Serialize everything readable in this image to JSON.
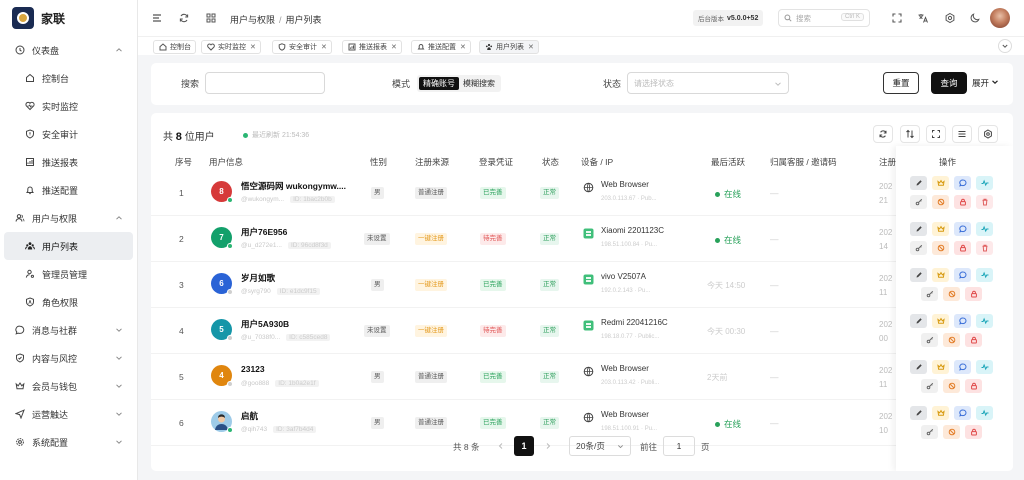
{
  "app": {
    "name": "家联"
  },
  "sidebar": {
    "groups": [
      {
        "label": "仪表盘",
        "expanded": true,
        "items": [
          "控制台",
          "实时监控",
          "安全审计",
          "推送报表",
          "推送配置"
        ]
      },
      {
        "label": "用户与权限",
        "expanded": true,
        "items": [
          "用户列表",
          "管理员管理",
          "角色权限"
        ]
      },
      {
        "label": "消息与社群"
      },
      {
        "label": "内容与风控"
      },
      {
        "label": "会员与钱包"
      },
      {
        "label": "运营触达"
      },
      {
        "label": "系统配置"
      }
    ],
    "active": "用户列表"
  },
  "header": {
    "breadcrumb": [
      "用户与权限",
      "用户列表"
    ],
    "version_label": "后台版本",
    "version": "v5.0.0+52",
    "search_placeholder": "搜索",
    "search_kbd": "Ctrl K"
  },
  "tabs": [
    {
      "label": "控制台",
      "closable": false
    },
    {
      "label": "实时监控",
      "closable": true
    },
    {
      "label": "安全审计",
      "closable": true
    },
    {
      "label": "推送报表",
      "closable": true
    },
    {
      "label": "推送配置",
      "closable": true
    },
    {
      "label": "用户列表",
      "closable": true,
      "active": true
    }
  ],
  "filter": {
    "search_label": "搜索",
    "mode_label": "模式",
    "mode_options": [
      "精确账号",
      "模糊搜索"
    ],
    "mode_selected": "精确账号",
    "status_label": "状态",
    "status_placeholder": "请选择状态",
    "reset": "重置",
    "query": "查询",
    "expand": "展开"
  },
  "table": {
    "count_prefix": "共",
    "count": "8",
    "count_suffix": "位用户",
    "refreshed": "最近刷新 21:54:36",
    "columns": [
      "序号",
      "用户信息",
      "性别",
      "注册来源",
      "登录凭证",
      "状态",
      "设备 / IP",
      "最后活跃",
      "归属客服 / 邀请码",
      "注册",
      "操作"
    ],
    "rows": [
      {
        "seq": "1",
        "avatar": "8",
        "avatar_color": "#d63a3a",
        "presence": "#2bb673",
        "name": "悟空源码网 wukongymw....",
        "sub": "@wukongym...",
        "sub_id": "ID: 1bac2b0b",
        "gender": "男",
        "source": "普通注册",
        "cred": "已完善",
        "cred_type": "green",
        "status": "正常",
        "device": "Web Browser",
        "device_type": "web",
        "ip": "203.0.113.67 · Pub...",
        "last": "在线",
        "online": true,
        "reg": "202\n21"
      },
      {
        "seq": "2",
        "avatar": "7",
        "avatar_color": "#13a06b",
        "presence": "#2bb673",
        "name": "用户76E956",
        "sub": "@u_d272e1...",
        "sub_id": "ID: 96cd8f3d",
        "gender": "未设置",
        "source": "一键注册",
        "source_type": "orange",
        "cred": "待完善",
        "cred_type": "red",
        "status": "正常",
        "device": "Xiaomi 2201123C",
        "device_type": "android",
        "ip": "198.51.100.84 · Pu...",
        "last": "在线",
        "online": true,
        "reg": "202\n14"
      },
      {
        "seq": "3",
        "avatar": "6",
        "avatar_color": "#2a63d6",
        "presence": "#cfcfcf",
        "name": "岁月如歌",
        "sub": "@syrg790",
        "sub_id": "ID: e1dc9f15",
        "gender": "男",
        "source": "一键注册",
        "source_type": "orange",
        "cred": "已完善",
        "cred_type": "green",
        "status": "正常",
        "device": "vivo V2507A",
        "device_type": "android",
        "ip": "192.0.2.143 · Pu...",
        "last": "今天 14:50",
        "online": false,
        "reg": "202\n11"
      },
      {
        "seq": "4",
        "avatar": "5",
        "avatar_color": "#1596a8",
        "presence": "#cfcfcf",
        "name": "用户5A930B",
        "sub": "@u_7038f0...",
        "sub_id": "ID: c585ced8",
        "gender": "未设置",
        "source": "一键注册",
        "source_type": "orange",
        "cred": "待完善",
        "cred_type": "red",
        "status": "正常",
        "device": "Redmi 22041216C",
        "device_type": "android",
        "ip": "198.18.0.77 · Public...",
        "last": "今天 00:30",
        "online": false,
        "reg": "202\n00"
      },
      {
        "seq": "5",
        "avatar": "4",
        "avatar_color": "#e0860e",
        "presence": "#cfcfcf",
        "name": "23123",
        "sub": "@goo888",
        "sub_id": "ID: 1b0a2e1f",
        "gender": "男",
        "source": "普通注册",
        "cred": "已完善",
        "cred_type": "green",
        "status": "正常",
        "device": "Web Browser",
        "device_type": "web",
        "ip": "203.0.113.42 · Publi...",
        "last": "2天前",
        "online": false,
        "reg": "202\n11"
      },
      {
        "seq": "6",
        "avatar": "",
        "avatar_color": "#9ecbe8",
        "presence": "#2bb673",
        "name": "启航",
        "sub": "@qih743",
        "sub_id": "ID: 3af7b4d4",
        "gender": "男",
        "source": "普通注册",
        "cred": "已完善",
        "cred_type": "green",
        "status": "正常",
        "device": "Web Browser",
        "device_type": "web",
        "ip": "198.51.100.91 · Pu...",
        "last": "在线",
        "online": true,
        "reg": "202\n10"
      }
    ],
    "operations_header": "操作"
  },
  "pagination": {
    "total": "共 8 条",
    "current": "1",
    "page_size": "20条/页",
    "goto_label": "前往",
    "goto_value": "1",
    "page_suffix": "页"
  }
}
